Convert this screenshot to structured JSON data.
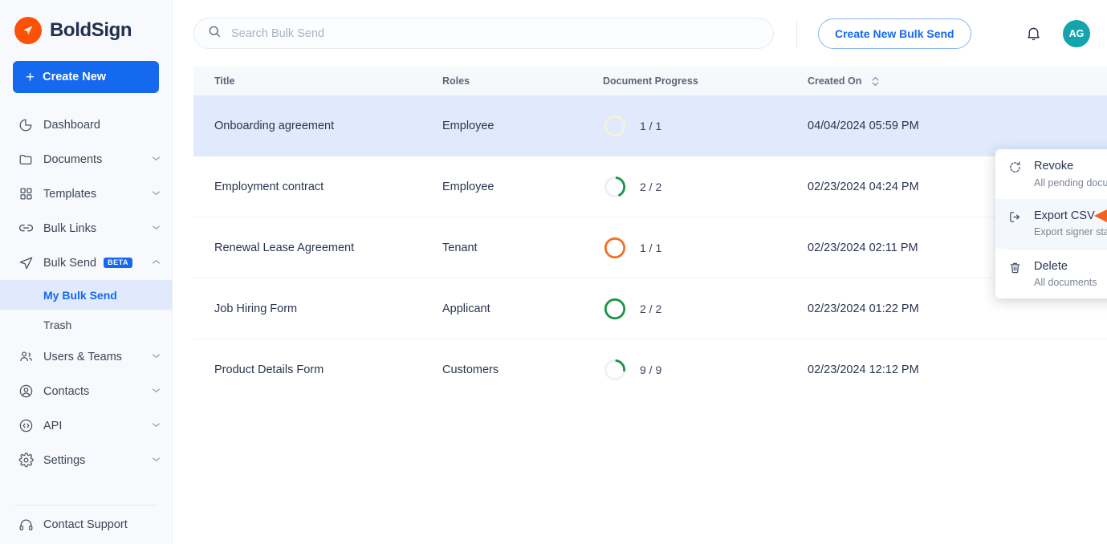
{
  "brand": {
    "name": "BoldSign",
    "logo_icon": "boldsign-logo-icon",
    "accent": "#fb5208"
  },
  "sidebar": {
    "create_new": {
      "label": "Create New",
      "icon": "plus-icon",
      "color": "#1569ef"
    },
    "items": [
      {
        "label": "Dashboard",
        "icon": "dashboard-pie-icon",
        "caret": false
      },
      {
        "label": "Documents",
        "icon": "folder-icon",
        "caret": true
      },
      {
        "label": "Templates",
        "icon": "grid-icon",
        "caret": true
      },
      {
        "label": "Bulk Links",
        "icon": "link-icon",
        "caret": true
      },
      {
        "label": "Bulk Send",
        "icon": "send-plane-icon",
        "caret": true,
        "badge": "BETA",
        "expanded": true
      },
      {
        "label": "Users & Teams",
        "icon": "users-icon",
        "caret": true
      },
      {
        "label": "Contacts",
        "icon": "contact-circle-icon",
        "caret": true
      },
      {
        "label": "API",
        "icon": "code-circle-icon",
        "caret": true
      },
      {
        "label": "Settings",
        "icon": "gear-icon",
        "caret": true
      }
    ],
    "sub_items": [
      {
        "label": "My Bulk Send",
        "active": true
      },
      {
        "label": "Trash",
        "active": false
      }
    ],
    "support": {
      "label": "Contact Support",
      "icon": "headset-icon"
    }
  },
  "topbar": {
    "search": {
      "placeholder": "Search Bulk Send",
      "value": "",
      "icon": "search-icon"
    },
    "create_bulk_send_label": "Create New Bulk Send",
    "notification_icon": "bell-icon",
    "avatar_initials": "AG",
    "avatar_color": "#14a5ac"
  },
  "table": {
    "columns": [
      "Title",
      "Roles",
      "Document Progress",
      "Created On"
    ],
    "sort_icon": "sort-updown-icon",
    "rows": [
      {
        "title": "Onboarding agreement",
        "role": "Employee",
        "progress": "1 / 1",
        "created": "04/04/2024 05:59 PM",
        "ring_color": "#f3f1dd",
        "ring_pct": 3,
        "selected": true
      },
      {
        "title": "Employment contract",
        "role": "Employee",
        "progress": "2 / 2",
        "created": "02/23/2024 04:24 PM",
        "ring_color": "#1d9447",
        "ring_pct": 42,
        "selected": false
      },
      {
        "title": "Renewal Lease Agreement",
        "role": "Tenant",
        "progress": "1 / 1",
        "created": "02/23/2024 02:11 PM",
        "ring_color": "#ef7322",
        "ring_pct": 100,
        "selected": false
      },
      {
        "title": "Job Hiring Form",
        "role": "Applicant",
        "progress": "2 / 2",
        "created": "02/23/2024 01:22 PM",
        "ring_color": "#1d9447",
        "ring_pct": 100,
        "selected": false
      },
      {
        "title": "Product Details Form",
        "role": "Customers",
        "progress": "9 / 9",
        "created": "02/23/2024 12:12 PM",
        "ring_color": "#1d9447",
        "ring_pct": 28,
        "selected": false
      }
    ]
  },
  "context_menu": {
    "items": [
      {
        "title": "Revoke",
        "subtitle": "All pending documents",
        "icon": "revoke-icon",
        "highlight": false
      },
      {
        "title": "Export CSV",
        "subtitle": "Export signer status, form data",
        "icon": "export-icon",
        "highlight": true
      },
      {
        "title": "Delete",
        "subtitle": "All documents",
        "icon": "trash-icon",
        "highlight": false
      }
    ]
  },
  "annotation": {
    "arrow_color": "#f4621f",
    "points_to": "Export CSV"
  }
}
